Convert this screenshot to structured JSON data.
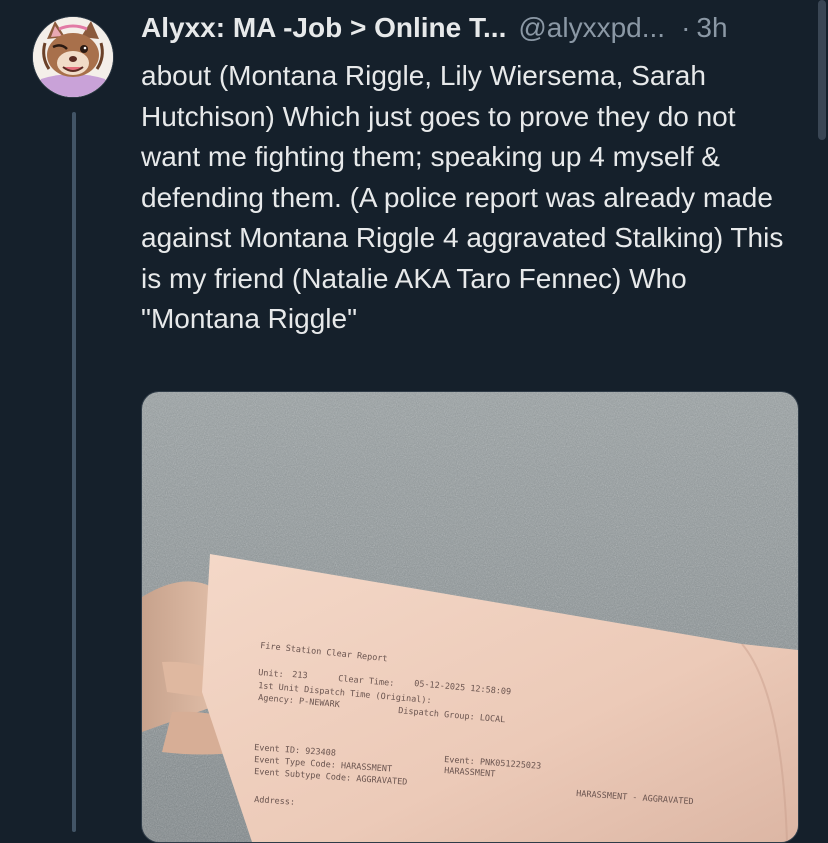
{
  "tweet": {
    "display_name": "Alyxx: MA -Job > Online T...",
    "handle": "@alyxxpd...",
    "separator": "·",
    "time": "3h",
    "text": "about (Montana Riggle, Lily Wiersema, Sarah Hutchison) Which just goes to prove they do not want me fighting them; speaking up 4 myself & defending them. (A police report was already made against Montana Riggle 4 aggravated Stalking) This is my friend (Natalie AKA Taro Fennec) Who \"Montana Riggle\""
  },
  "photo": {
    "report_title": "Fire Station Clear Report",
    "unit_label": "Unit:",
    "unit_value": "213",
    "clear_time_label": "Clear Time:",
    "clear_time_value": "05-12-2025  12:58:09",
    "dispatch_label": "1st Unit Dispatch Time (Original):",
    "agency_label": "Agency: P-NEWARK",
    "dispatch_group": "Dispatch Group: LOCAL",
    "event_id": "Event ID: 923408",
    "event_type": "Event Type Code: HARASSMENT",
    "event_subtype": "Event Subtype Code: AGGRAVATED",
    "event_ref": "Event: PNK051225023",
    "event_ref2": "HARASSMENT",
    "right_code": "HARASSMENT - AGGRAVATED",
    "address_label": "Address:"
  },
  "colors": {
    "background": "#15202b",
    "text": "#e7e9ea",
    "muted": "#8b98a5",
    "thread_line": "#425466"
  }
}
